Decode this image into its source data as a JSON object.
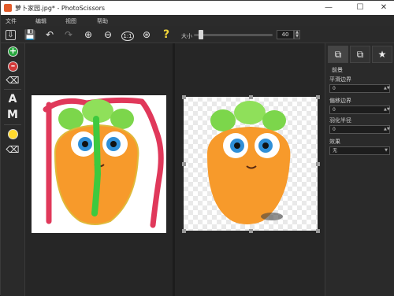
{
  "window": {
    "title": "萝卜家园.jpg* - PhotoScissors",
    "minimize_icon": "minimize-icon",
    "maximize_icon": "maximize-icon",
    "close_icon": "close-icon"
  },
  "menu": {
    "file": "文件",
    "edit": "编辑",
    "view": "视图",
    "help": "帮助"
  },
  "toolbar": {
    "size_label": "大小",
    "brush_size": "40",
    "brush_size_level": 0.06
  },
  "right_panel": {
    "section_title": "前景",
    "smooth_edge_label": "平滑边界",
    "smooth_edge_value": "0",
    "offset_edge_label": "偏移边界",
    "offset_edge_value": "0",
    "feather_radius_label": "羽化半径",
    "feather_radius_value": "0",
    "effect_label": "效果",
    "effect_value": "无"
  },
  "colors": {
    "keep_marker": "#3ec93e",
    "remove_marker": "#e0385a",
    "accent_yellow": "#ffd92e"
  }
}
